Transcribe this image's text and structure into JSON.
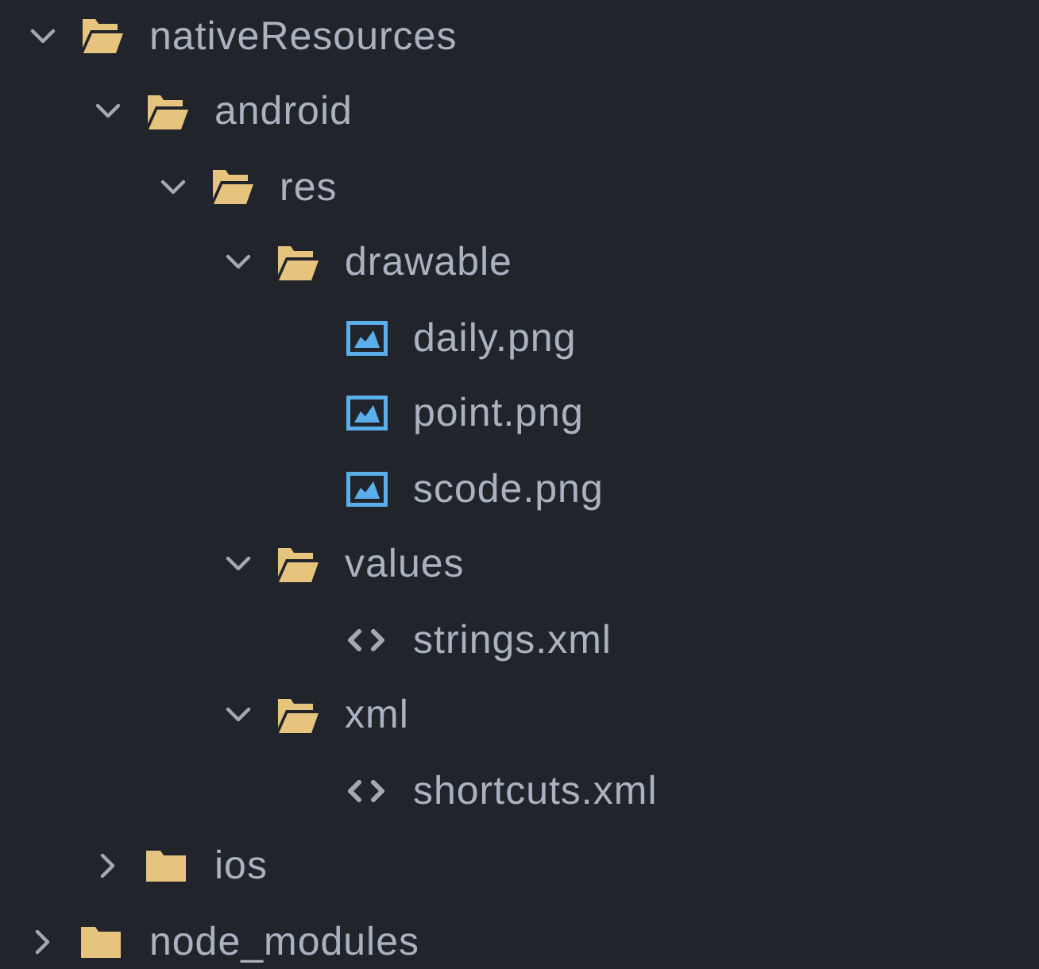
{
  "tree": [
    {
      "kind": "folder",
      "name": "nativeResources",
      "expanded": true,
      "children": [
        {
          "kind": "folder",
          "name": "android",
          "expanded": true,
          "children": [
            {
              "kind": "folder",
              "name": "res",
              "expanded": true,
              "children": [
                {
                  "kind": "folder",
                  "name": "drawable",
                  "expanded": true,
                  "children": [
                    {
                      "kind": "image",
                      "name": "daily.png"
                    },
                    {
                      "kind": "image",
                      "name": "point.png"
                    },
                    {
                      "kind": "image",
                      "name": "scode.png"
                    }
                  ]
                },
                {
                  "kind": "folder",
                  "name": "values",
                  "expanded": true,
                  "children": [
                    {
                      "kind": "code",
                      "name": "strings.xml"
                    }
                  ]
                },
                {
                  "kind": "folder",
                  "name": "xml",
                  "expanded": true,
                  "children": [
                    {
                      "kind": "code",
                      "name": "shortcuts.xml"
                    }
                  ]
                }
              ]
            }
          ]
        },
        {
          "kind": "folder",
          "name": "ios",
          "expanded": false
        }
      ]
    },
    {
      "kind": "folder",
      "name": "node_modules",
      "expanded": false
    }
  ]
}
